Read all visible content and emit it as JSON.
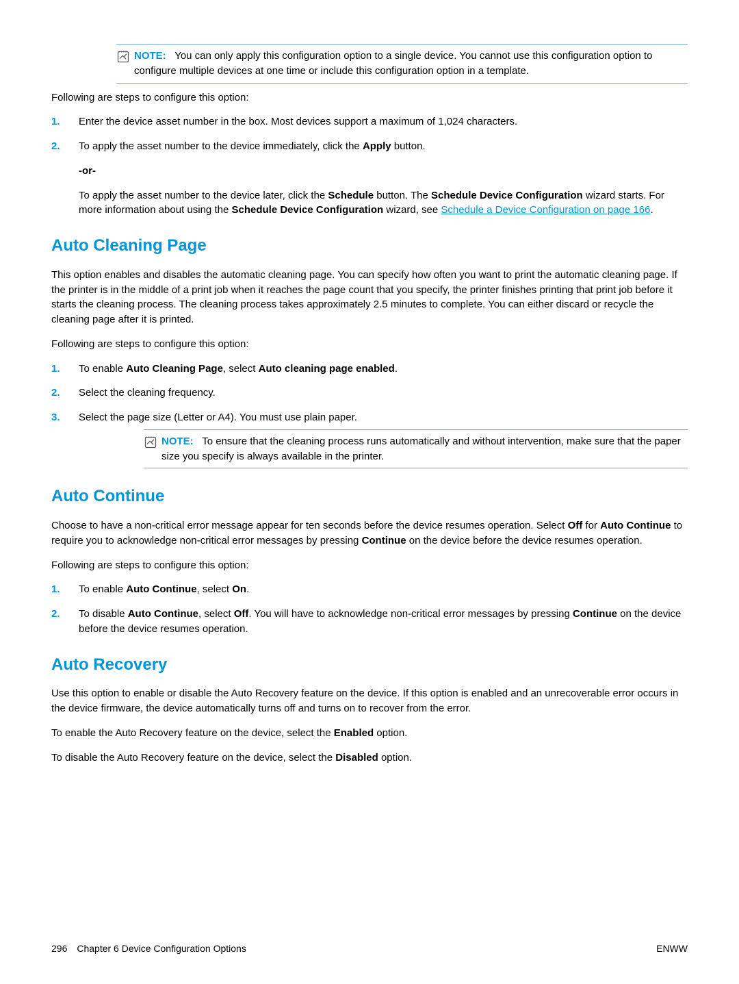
{
  "note1": {
    "label": "NOTE:",
    "text": "You can only apply this configuration option to a single device. You cannot use this configuration option to configure multiple devices at one time or include this configuration option in a template."
  },
  "intro1": "Following are steps to configure this option:",
  "steps1": [
    {
      "n": "1.",
      "t": "Enter the device asset number in the box. Most devices support a maximum of 1,024 characters."
    },
    {
      "n": "2.",
      "pre": "To apply the asset number to the device immediately, click the ",
      "b1": "Apply",
      "post": " button."
    }
  ],
  "or": "-or-",
  "sched": {
    "p1": "To apply the asset number to the device later, click the ",
    "b1": "Schedule",
    "p2": " button. The ",
    "b2": "Schedule Device Configuration",
    "p3": " wizard starts. For more information about using the ",
    "b3": "Schedule Device Configuration",
    "p4": " wizard, see ",
    "link": "Schedule a Device Configuration on page 166",
    "p5": "."
  },
  "h_cleaning": "Auto Cleaning Page",
  "cleaning_intro": "This option enables and disables the automatic cleaning page. You can specify how often you want to print the automatic cleaning page. If the printer is in the middle of a print job when it reaches the page count that you specify, the printer finishes printing that print job before it starts the cleaning process. The cleaning process takes approximately 2.5 minutes to complete. You can either discard or recycle the cleaning page after it is printed.",
  "intro2": "Following are steps to configure this option:",
  "steps2": {
    "1": {
      "n": "1.",
      "pre": "To enable ",
      "b1": "Auto Cleaning Page",
      "mid": ", select ",
      "b2": "Auto cleaning page enabled",
      "post": "."
    },
    "2": {
      "n": "2.",
      "t": "Select the cleaning frequency."
    },
    "3": {
      "n": "3.",
      "t": "Select the page size (Letter or A4). You must use plain paper."
    }
  },
  "note2": {
    "label": "NOTE:",
    "text": "To ensure that the cleaning process runs automatically and without intervention, make sure that the paper size you specify is always available in the printer."
  },
  "h_continue": "Auto Continue",
  "continue_intro": {
    "p1": "Choose to have a non-critical error message appear for ten seconds before the device resumes operation. Select ",
    "b1": "Off",
    "p2": " for ",
    "b2": "Auto Continue",
    "p3": " to require you to acknowledge non-critical error messages by pressing ",
    "b3": "Continue",
    "p4": " on the device before the device resumes operation."
  },
  "intro3": "Following are steps to configure this option:",
  "steps3": {
    "1": {
      "n": "1.",
      "pre": "To enable ",
      "b1": "Auto Continue",
      "mid": ", select ",
      "b2": "On",
      "post": "."
    },
    "2": {
      "n": "2.",
      "pre": "To disable ",
      "b1": "Auto Continue",
      "mid": ", select ",
      "b2": "Off",
      "post1": ". You will have to acknowledge non-critical error messages by pressing ",
      "b3": "Continue",
      "post2": " on the device before the device resumes operation."
    }
  },
  "h_recovery": "Auto Recovery",
  "recovery_intro": "Use this option to enable or disable the Auto Recovery feature on the device. If this option is enabled and an unrecoverable error occurs in the device firmware, the device automatically turns off and turns on to recover from the error.",
  "recovery_enable": {
    "p1": "To enable the Auto Recovery feature on the device, select the ",
    "b": "Enabled",
    "p2": " option."
  },
  "recovery_disable": {
    "p1": "To disable the Auto Recovery feature on the device, select the ",
    "b": "Disabled",
    "p2": " option."
  },
  "footer": {
    "pnum": "296",
    "chapter": "Chapter 6   Device Configuration Options",
    "right": "ENWW"
  }
}
